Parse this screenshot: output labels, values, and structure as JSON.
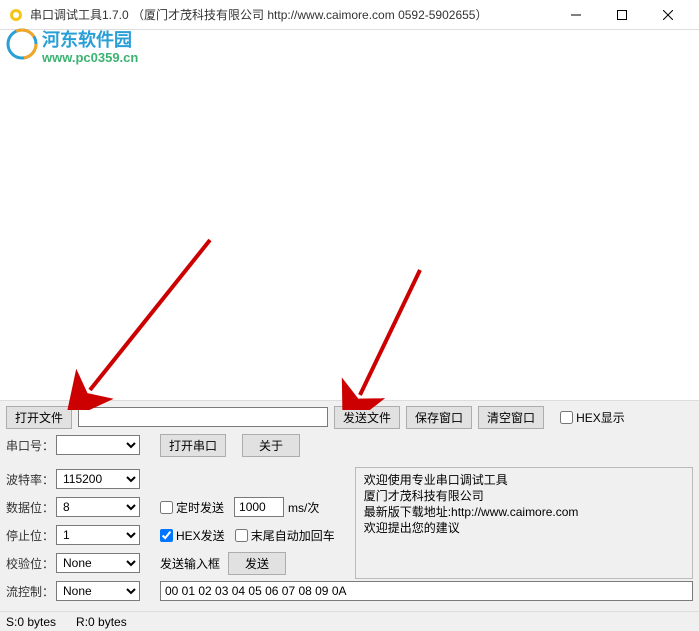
{
  "titlebar": {
    "title": "串口调试工具1.7.0  （厦门才茂科技有限公司 http://www.caimore.com 0592-5902655）"
  },
  "watermark": {
    "line1": "河东软件园",
    "line2": "www.pc0359.cn"
  },
  "buttons": {
    "open_file": "打开文件",
    "send_file": "发送文件",
    "save_window": "保存窗口",
    "clear_window": "清空窗口",
    "open_port": "打开串口",
    "about": "关于",
    "send": "发送"
  },
  "labels": {
    "port": "串口号：",
    "baud": "波特率：",
    "databits": "数据位：",
    "stopbits": "停止位：",
    "parity": "校验位：",
    "flow": "流控制：",
    "hex_display": "HEX显示",
    "timed_send": "定时发送",
    "ms_per": "ms/次",
    "hex_send": "HEX发送",
    "append_crlf": "末尾自动加回车",
    "send_input": "发送输入框"
  },
  "values": {
    "file_path": "",
    "port": "",
    "baud": "115200",
    "databits": "8",
    "stopbits": "1",
    "parity": "None",
    "flow": "None",
    "interval": "1000",
    "hex_box": "00 01 02 03 04 05 06 07 08 09 0A"
  },
  "info": {
    "line1": "欢迎使用专业串口调试工具",
    "line2": "厦门才茂科技有限公司",
    "line3": "最新版下载地址:http://www.caimore.com",
    "line4": "欢迎提出您的建议"
  },
  "status": {
    "s": "S:0 bytes",
    "r": "R:0 bytes"
  }
}
